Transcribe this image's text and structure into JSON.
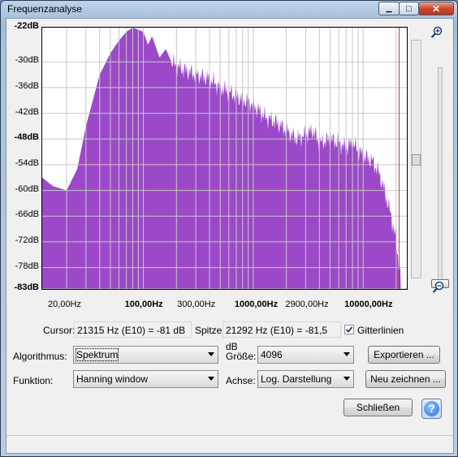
{
  "window": {
    "title": "Frequenzanalyse",
    "min_glyph": "▁",
    "max_glyph": "□",
    "close_glyph": "✕"
  },
  "axis": {
    "y_labels": [
      "-22dB",
      "-30dB",
      "-36dB",
      "-42dB",
      "-48dB",
      "-54dB",
      "-60dB",
      "-66dB",
      "-72dB",
      "-78dB",
      "-83dB"
    ],
    "x_labels": [
      "20,00Hz",
      "100,00Hz",
      "300,00Hz",
      "1000,00Hz",
      "2900,00Hz",
      "10000,00Hz"
    ]
  },
  "chart_data": {
    "type": "area",
    "x_scale": "log",
    "xlim": [
      12,
      25000
    ],
    "ylim": [
      -83,
      -22
    ],
    "grid": true,
    "color": "#9b49c8",
    "x": [
      12,
      15,
      20,
      25,
      30,
      40,
      50,
      60,
      70,
      80,
      90,
      100,
      110,
      120,
      140,
      160,
      180,
      200,
      240,
      300,
      400,
      500,
      700,
      1000,
      1300,
      1600,
      2000,
      2500,
      3000,
      3500,
      4000,
      5000,
      6000,
      7000,
      8000,
      10000,
      12000,
      14000,
      16000,
      18000,
      20000,
      22000
    ],
    "y": [
      -57,
      -59,
      -60,
      -55,
      -45,
      -33,
      -28,
      -25,
      -23,
      -22,
      -22.5,
      -23,
      -26,
      -24,
      -29,
      -27,
      -30,
      -31,
      -32,
      -33,
      -34,
      -36,
      -38,
      -40,
      -43,
      -44,
      -46,
      -48,
      -47,
      -46,
      -49,
      -48,
      -49,
      -50,
      -49,
      -52,
      -53,
      -56,
      -61,
      -66,
      -72,
      -81
    ]
  },
  "controls": {
    "cursor_label": "Cursor:",
    "cursor_value": "21315 Hz (E10) = -81 dB",
    "peak_label": "Spitze:",
    "peak_value": "21292 Hz (E10) = -81,5 dB",
    "grid_label": "Gitterlinien",
    "grid_checked": true,
    "algorithm_label": "Algorithmus:",
    "algorithm_value": "Spektrum",
    "size_label": "Größe:",
    "size_value": "4096",
    "export_button": "Exportieren ...",
    "function_label": "Funktion:",
    "function_value": "Hanning window",
    "axis_label": "Achse:",
    "axis_value": "Log. Darstellung",
    "redraw_button": "Neu zeichnen ...",
    "close_button": "Schließen",
    "help_glyph": "?"
  }
}
